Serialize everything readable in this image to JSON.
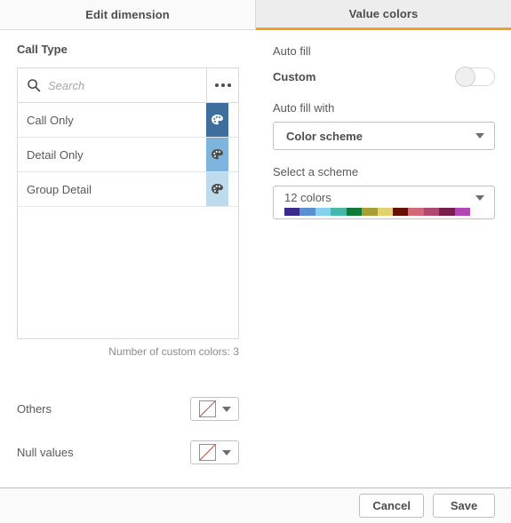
{
  "tabs": [
    {
      "label": "Edit dimension",
      "active": false
    },
    {
      "label": "Value colors",
      "active": true
    }
  ],
  "accent_color": "#f29e22",
  "left": {
    "title": "Call Type",
    "search": {
      "placeholder": "Search",
      "icon": "search-icon"
    },
    "menu_icon": "kebab-menu-icon",
    "rows": [
      {
        "label": "Call Only",
        "color": "#3d6e9e"
      },
      {
        "label": "Detail Only",
        "color": "#7db5de"
      },
      {
        "label": "Group Detail",
        "color": "#bedbee"
      }
    ],
    "custom_colors_text": "Number of custom colors: 3",
    "others": {
      "label": "Others",
      "value": "no-color"
    },
    "nulls": {
      "label": "Null values",
      "value": "no-color"
    }
  },
  "right": {
    "auto_fill_label": "Auto fill",
    "custom_label": "Custom",
    "custom_toggle_on": false,
    "auto_fill_with_label": "Auto fill with",
    "auto_fill_with_value": "Color scheme",
    "select_scheme_label": "Select a scheme",
    "scheme_value": "12 colors",
    "scheme_colors": [
      "#3b2a8c",
      "#5a8fd0",
      "#87d1ee",
      "#45b8ac",
      "#0f7b3b",
      "#a79e36",
      "#e2d26e",
      "#661000",
      "#d4687b",
      "#b0486f",
      "#7a1f4d",
      "#b446b4"
    ]
  },
  "footer": {
    "cancel_label": "Cancel",
    "save_label": "Save"
  }
}
